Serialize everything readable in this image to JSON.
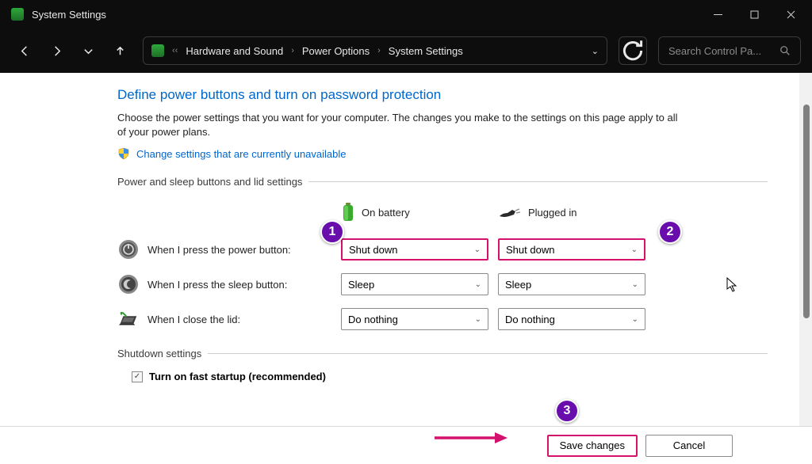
{
  "window": {
    "title": "System Settings"
  },
  "breadcrumb": {
    "items": [
      "Hardware and Sound",
      "Power Options",
      "System Settings"
    ]
  },
  "search": {
    "placeholder": "Search Control Pa..."
  },
  "page": {
    "heading": "Define power buttons and turn on password protection",
    "description": "Choose the power settings that you want for your computer. The changes you make to the settings on this page apply to all of your power plans.",
    "admin_link": "Change settings that are currently unavailable",
    "group1_label": "Power and sleep buttons and lid settings",
    "columns": {
      "battery": "On battery",
      "plugged": "Plugged in"
    },
    "rows": {
      "power": {
        "label": "When I press the power button:",
        "battery": "Shut down",
        "plugged": "Shut down"
      },
      "sleep": {
        "label": "When I press the sleep button:",
        "battery": "Sleep",
        "plugged": "Sleep"
      },
      "lid": {
        "label": "When I close the lid:",
        "battery": "Do nothing",
        "plugged": "Do nothing"
      }
    },
    "group2_label": "Shutdown settings",
    "fast_startup_label": "Turn on fast startup (recommended)"
  },
  "footer": {
    "save": "Save changes",
    "cancel": "Cancel"
  },
  "annotations": {
    "b1": "1",
    "b2": "2",
    "b3": "3"
  }
}
